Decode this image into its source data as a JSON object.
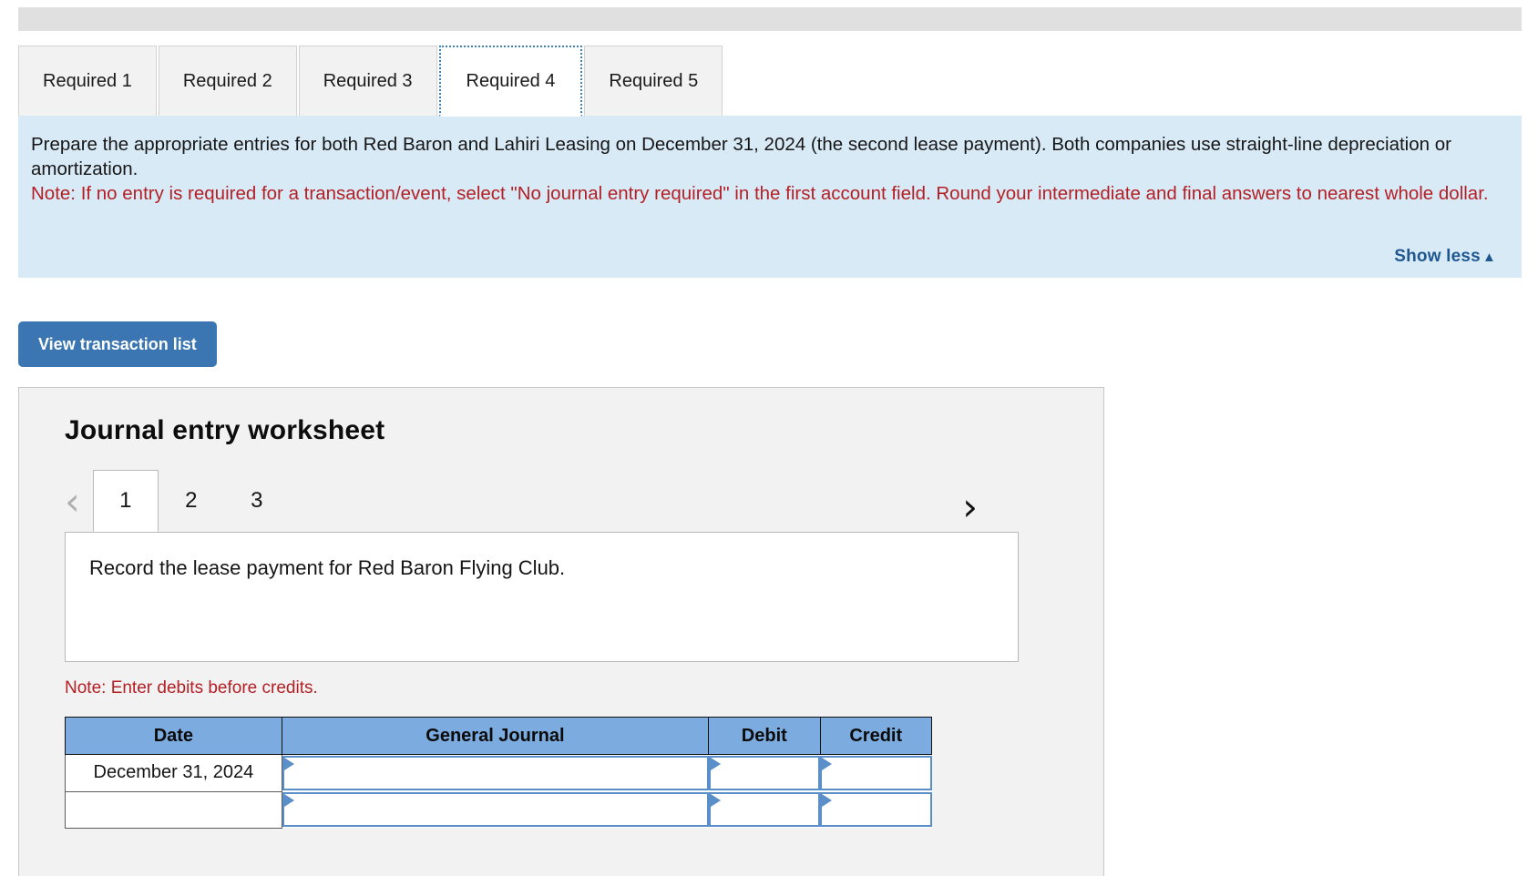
{
  "tabs": [
    {
      "label": "Required 1",
      "active": false
    },
    {
      "label": "Required 2",
      "active": false
    },
    {
      "label": "Required 3",
      "active": false
    },
    {
      "label": "Required 4",
      "active": true
    },
    {
      "label": "Required 5",
      "active": false
    }
  ],
  "instructions": {
    "line1": "Prepare the appropriate entries for both Red Baron and Lahiri Leasing on December 31, 2024 (the second lease payment). Both companies use straight-line depreciation or amortization.",
    "note": "Note: If no entry is required for a transaction/event, select \"No journal entry required\" in the first account field. Round your intermediate and final answers to nearest whole dollar.",
    "show_less_label": "Show less",
    "show_less_caret": "▲",
    "bg_color": "#d9eaf7",
    "note_color": "#b41f24",
    "link_color": "#1f5791"
  },
  "transaction_button": {
    "label": "View transaction list",
    "color": "#3b75b2"
  },
  "worksheet": {
    "title": "Journal entry worksheet",
    "prev_arrow": "‹",
    "next_arrow": "›",
    "pages": [
      {
        "label": "1",
        "active": true
      },
      {
        "label": "2",
        "active": false
      },
      {
        "label": "3",
        "active": false
      }
    ],
    "description": "Record the lease payment for Red Baron Flying Club.",
    "debit_note": "Note: Enter debits before credits.",
    "table": {
      "headers": [
        "Date",
        "General Journal",
        "Debit",
        "Credit"
      ],
      "header_color": "#7babdf",
      "rows": [
        {
          "date": "December 31, 2024",
          "general_journal": "",
          "debit": "",
          "credit": ""
        },
        {
          "date": "",
          "general_journal": "",
          "debit": "",
          "credit": ""
        }
      ]
    }
  }
}
